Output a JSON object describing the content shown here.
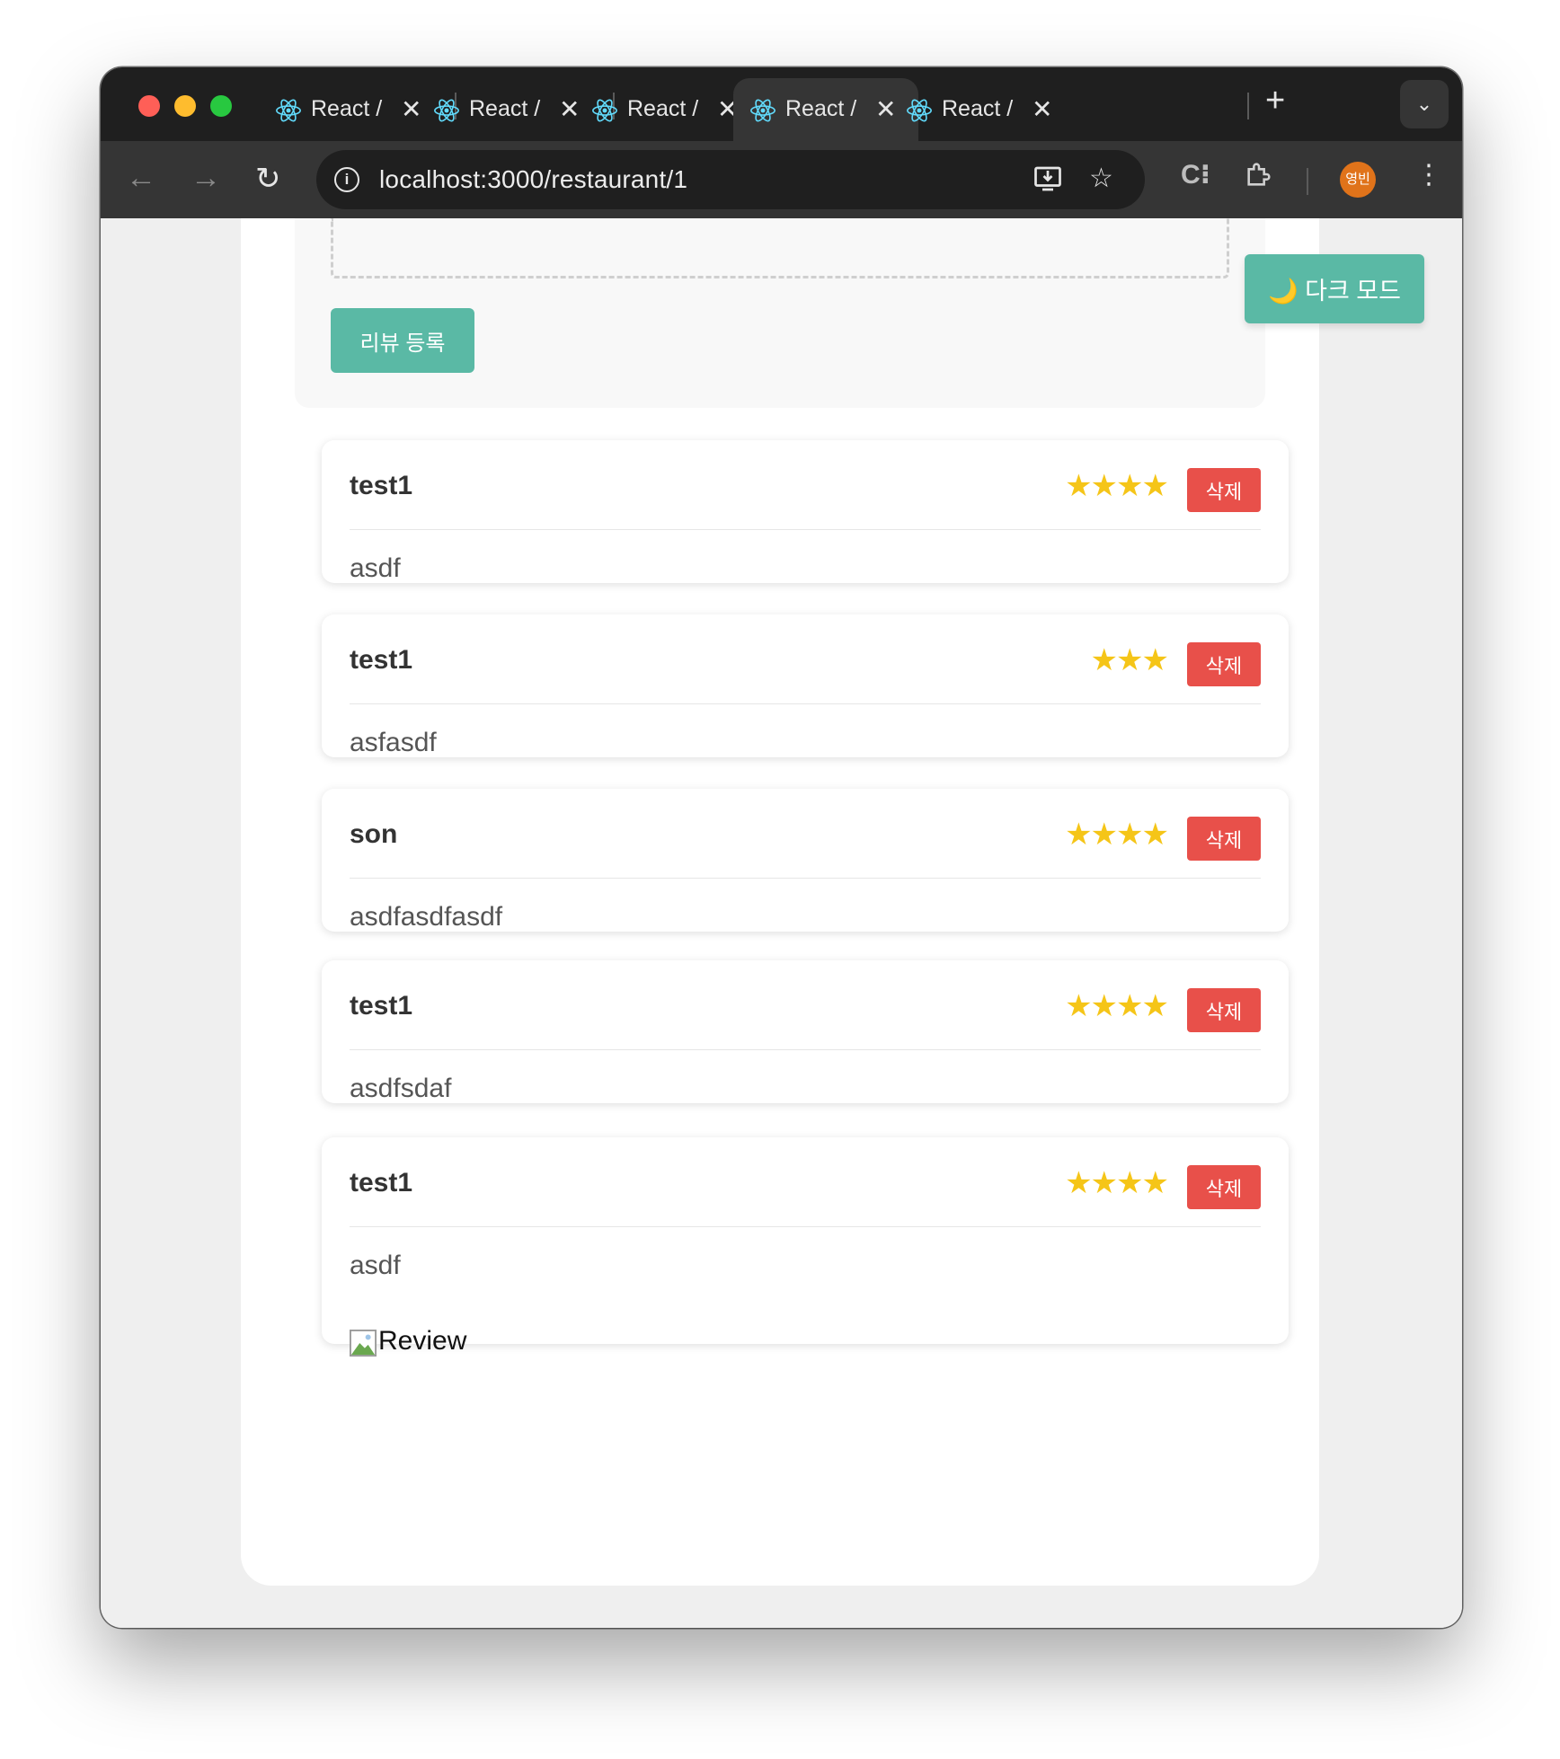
{
  "browser": {
    "tabs": [
      {
        "label": "React /"
      },
      {
        "label": "React /"
      },
      {
        "label": "React /"
      },
      {
        "label": "React /"
      },
      {
        "label": "React /"
      }
    ],
    "active_tab_index": 3,
    "url": "localhost:3000/restaurant/1",
    "profile_avatar_text": "영빈",
    "icons": {
      "tab_favicon": "react-icon",
      "close": "close-icon",
      "new_tab": "plus-icon",
      "tab_search": "chevron-down-icon",
      "back": "arrow-left-icon",
      "forward": "arrow-right-icon",
      "reload": "reload-icon",
      "site_info": "info-icon",
      "install": "install-app-icon",
      "bookmark": "star-outline-icon",
      "extension_c": "extension-icon",
      "extensions": "puzzle-icon",
      "menu": "kebab-menu-icon"
    }
  },
  "page": {
    "review_form": {
      "submit_label": "리뷰 등록"
    },
    "dark_mode_button": {
      "label": "🌙 다크 모드"
    },
    "reviews": [
      {
        "author": "test1",
        "rating": 4,
        "content": "asdf",
        "delete_label": "삭제"
      },
      {
        "author": "test1",
        "rating": 3,
        "content": "asfasdf",
        "delete_label": "삭제"
      },
      {
        "author": "son",
        "rating": 4,
        "content": "asdfasdfasdf",
        "delete_label": "삭제"
      },
      {
        "author": "test1",
        "rating": 4,
        "content": "asdfsdaf",
        "delete_label": "삭제"
      },
      {
        "author": "test1",
        "rating": 4,
        "content": "asdf",
        "delete_label": "삭제",
        "image_alt": "Review"
      }
    ]
  },
  "colors": {
    "accent": "#5ab9a5",
    "danger": "#e8504a",
    "star": "#f5c518",
    "chrome_dark": "#1f1f1f",
    "toolbar": "#353535",
    "page_bg": "#efefef"
  }
}
